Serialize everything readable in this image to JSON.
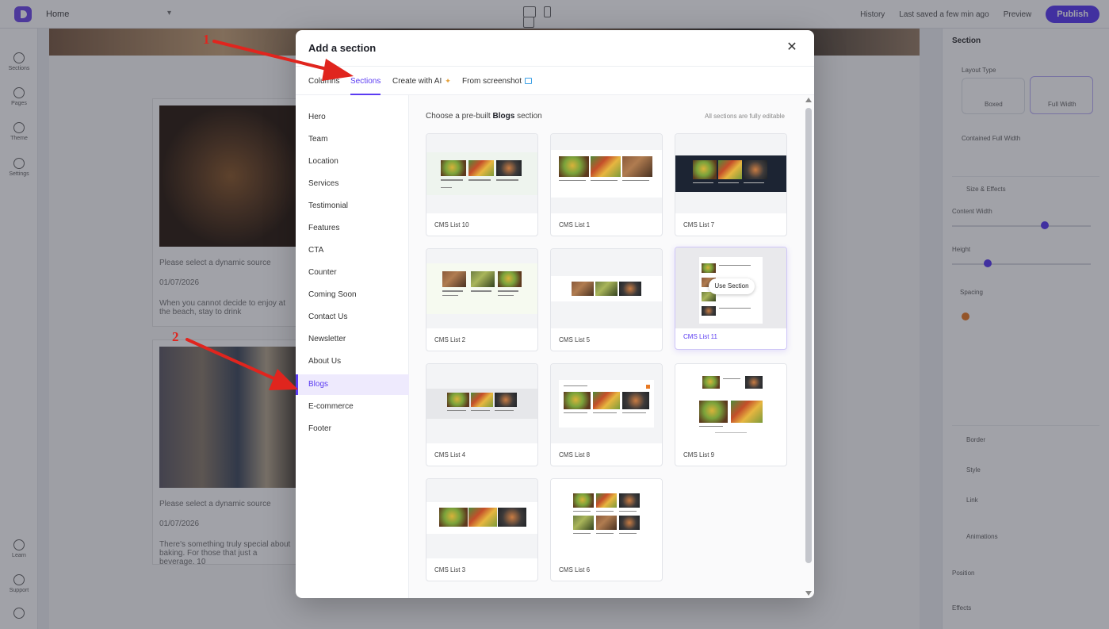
{
  "app": {
    "page_selector": "Home",
    "top_right": {
      "history": "History",
      "last_saved": "Last saved a few min ago",
      "preview": "Preview",
      "publish": "Publish"
    },
    "left_rail": [
      "Sections",
      "Pages",
      "Theme",
      "Settings",
      "Learn",
      "Support"
    ]
  },
  "background": {
    "card1": {
      "title": "Please select a dynamic source",
      "date": "01/07/2026",
      "excerpt": "When you cannot decide to enjoy at the beach, stay to drink"
    },
    "card2": {
      "title": "Please select a dynamic source",
      "date": "01/07/2026",
      "excerpt": "There's something truly special about baking. For those that just a beverage. 10"
    }
  },
  "right_panel": {
    "title": "Section",
    "layout_label": "Layout Type",
    "layout_options": [
      "Boxed",
      "Full Width"
    ],
    "contained": "Contained Full Width",
    "bg_label": "Size & Effects",
    "content_width": "Content Width",
    "height": "Height",
    "padding_label": "Spacing",
    "groups": [
      "Border",
      "Style",
      "Link",
      "Animations",
      "Position",
      "Effects"
    ]
  },
  "modal": {
    "title": "Add a section",
    "close_icon": "close-icon",
    "tabs": [
      {
        "label": "Columns"
      },
      {
        "label": "Sections",
        "active": true
      },
      {
        "label": "Create with AI",
        "icon": "sparkle-icon"
      },
      {
        "label": "From screenshot",
        "icon": "image-icon"
      }
    ],
    "categories": [
      "Hero",
      "Team",
      "Location",
      "Services",
      "Testimonial",
      "Features",
      "CTA",
      "Counter",
      "Coming Soon",
      "Contact Us",
      "Newsletter",
      "About Us",
      "Blogs",
      "E-commerce",
      "Footer"
    ],
    "active_category": "Blogs",
    "choose_prefix": "Choose a pre-built",
    "choose_category": "Blogs",
    "choose_suffix": "section",
    "editable_note": "All sections are fully editable",
    "use_section": "Use Section",
    "cards": [
      "CMS List 10",
      "CMS List 1",
      "CMS List 7",
      "CMS List 2",
      "CMS List 5",
      "CMS List 11",
      "CMS List 4",
      "CMS List 8",
      "CMS List 9",
      "CMS List 3",
      "CMS List 6"
    ]
  },
  "annotations": {
    "arrow1_number": "1",
    "arrow2_number": "2",
    "color": "#e0251e"
  },
  "colors": {
    "accent": "#5b3cf2",
    "overlay": "#1e2230"
  }
}
